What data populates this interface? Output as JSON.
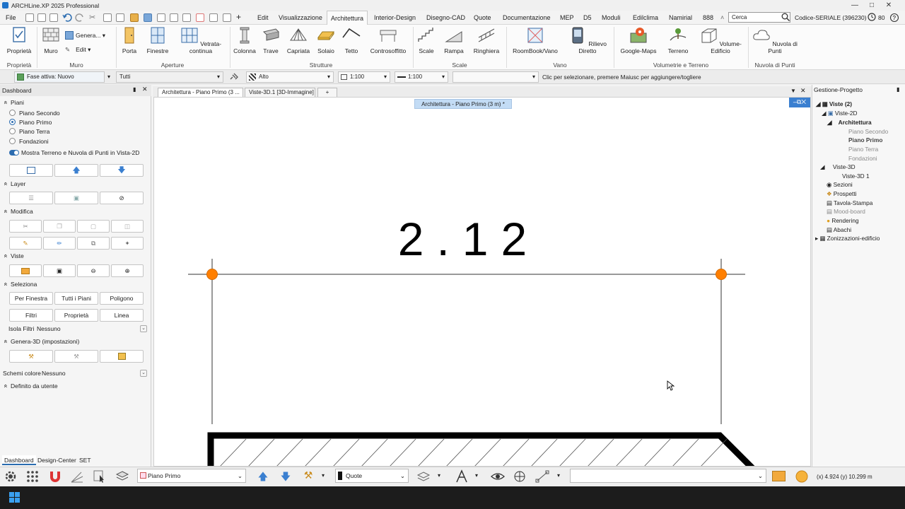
{
  "app": {
    "title": "ARCHLine.XP 2025 Professional"
  },
  "menu": {
    "items": [
      "File",
      "Edit",
      "Visualizzazione",
      "Architettura",
      "Interior-Design",
      "Disegno-CAD",
      "Quote",
      "Documentazione",
      "MEP",
      "D5",
      "Moduli",
      "Edilclima",
      "Namirial",
      "888"
    ],
    "active": "Architettura",
    "search_placeholder": "Cerca",
    "serial": "Codice-SERIALE (396230)",
    "counter": "80"
  },
  "ribbon": {
    "buttons": {
      "proprieta": "Proprietà",
      "muro": "Muro",
      "genera": "Genera...",
      "edit": "Edit",
      "porta": "Porta",
      "finestre": "Finestre",
      "vetrata": "Vetrata-continua",
      "colonna": "Colonna",
      "trave": "Trave",
      "capriata": "Capriata",
      "solaio": "Solaio",
      "tetto": "Tetto",
      "controsoffitto": "Controsoffitto",
      "scale": "Scale",
      "rampa": "Rampa",
      "ringhiera": "Ringhiera",
      "roombook": "RoomBook/Vano",
      "rilievo": "Rilievo Diretto",
      "googlemaps": "Google-Maps",
      "terreno": "Terreno",
      "volume": "Volume-Edificio",
      "nuvola": "Nuvola di Punti"
    },
    "groups": {
      "proprieta": "Proprietà",
      "muro": "Muro",
      "aperture": "Aperture",
      "strutture": "Strutture",
      "scale": "Scale",
      "vano": "Vano",
      "volumetrie": "Volumetrie e Terreno",
      "nuvola": "Nuvola di Punti"
    }
  },
  "propbar": {
    "fase": "Fase attiva: Nuovo",
    "tutti": "Tutti",
    "alto": "Alto",
    "scale1": "1:100",
    "scale2": "1:100",
    "hint": "Clic per selezionare, premere Maiusc per aggiungere/togliere"
  },
  "dashboard": {
    "title": "Dashboard",
    "piani_title": "Piani",
    "piani": [
      "Piano Secondo",
      "Piano Primo",
      "Piano Terra",
      "Fondazioni"
    ],
    "piano_selected": "Piano Primo",
    "toggle_label": "Mostra Terreno e Nuvola di Punti in Vista-2D",
    "layer_title": "Layer",
    "modifica_title": "Modifica",
    "viste_title": "Viste",
    "seleziona_title": "Seleziona",
    "seleziona_buttons": [
      "Per Finestra",
      "Tutti i Piani",
      "Poligono",
      "Filtri",
      "Proprietà",
      "Linea"
    ],
    "isola_label": "Isola Filtri",
    "isola_value": "Nessuno",
    "genera3d_title": "Genera-3D (impostazioni)",
    "schemi_label": "Schemi colore",
    "schemi_value": "Nessuno",
    "definito_title": "Definito da utente",
    "tabs": [
      "Dashboard",
      "Design-Center",
      "SET"
    ]
  },
  "doc_tabs": [
    "Architettura - Piano Primo (3 ...",
    "Viste-3D.1 [3D-Immagine]",
    "+"
  ],
  "canvas": {
    "view_label": "Architettura - Piano Primo (3 m) *",
    "dimension_text": "2.12"
  },
  "project": {
    "title": "Gestione-Progetto",
    "tree": {
      "viste": "Viste (2)",
      "viste2d": "Viste-2D",
      "architettura": "Architettura",
      "piano_secondo": "Piano Secondo",
      "piano_primo": "Piano Primo",
      "piano_terra": "Piano Terra",
      "fondazioni": "Fondazioni",
      "viste3d": "Viste-3D",
      "viste3d1": "Viste-3D 1",
      "sezioni": "Sezioni",
      "prospetti": "Prospetti",
      "tavola": "Tavola-Stampa",
      "moodboard": "Mood-board",
      "rendering": "Rendering",
      "abachi": "Abachi",
      "zonizzazioni": "Zonizzazioni-edificio"
    }
  },
  "bottom": {
    "piano": "Piano Primo",
    "quote": "Quote",
    "coords": "(x) 4.924  (y) 10.299 m"
  },
  "colors": {
    "accent": "#1f72c8",
    "handle": "#ff7f00",
    "active_tab": "#c3dcf5"
  }
}
